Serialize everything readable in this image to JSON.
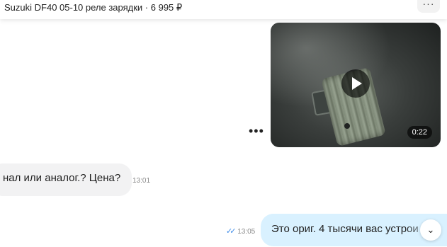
{
  "header": {
    "title": "Suzuki DF40 05-10 реле зарядки · 6 995 ₽",
    "menu_icon": "more-horizontal-icon",
    "menu_label": "···"
  },
  "messages": [
    {
      "type": "video",
      "direction": "outgoing",
      "duration": "0:22",
      "play_icon": "play-icon",
      "more_label": "•••"
    },
    {
      "type": "text",
      "direction": "incoming",
      "text": "нал или аналог.? Цена?",
      "time": "13:01"
    },
    {
      "type": "text",
      "direction": "outgoing",
      "text": "Это ориг. 4 тысячи вас устрои",
      "time": "13:05",
      "read_icon": "double-check-icon",
      "read_glyph": "✓✓",
      "read_color": "#3d8be8"
    }
  ],
  "scroll_down": {
    "icon": "chevron-down-icon",
    "glyph": "⌄"
  },
  "colors": {
    "outgoing_bubble": "#d9f1ff",
    "incoming_bubble": "#f2f2f3",
    "timestamp": "#8a8a8a"
  }
}
